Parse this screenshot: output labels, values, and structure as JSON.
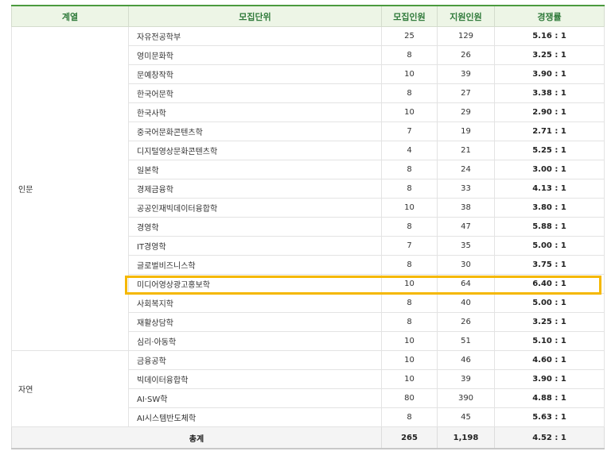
{
  "header": {
    "group": "계열",
    "unit": "모집단위",
    "quota": "모집인원",
    "applicants": "지원인원",
    "rate": "경쟁률"
  },
  "groups": [
    {
      "name": "인문",
      "rows": [
        {
          "unit": "자유전공학부",
          "quota": "25",
          "applicants": "129",
          "rate": "5.16 : 1"
        },
        {
          "unit": "영미문화학",
          "quota": "8",
          "applicants": "26",
          "rate": "3.25 : 1"
        },
        {
          "unit": "문예창작학",
          "quota": "10",
          "applicants": "39",
          "rate": "3.90 : 1"
        },
        {
          "unit": "한국어문학",
          "quota": "8",
          "applicants": "27",
          "rate": "3.38 : 1"
        },
        {
          "unit": "한국사학",
          "quota": "10",
          "applicants": "29",
          "rate": "2.90 : 1"
        },
        {
          "unit": "중국어문화콘텐츠학",
          "quota": "7",
          "applicants": "19",
          "rate": "2.71 : 1"
        },
        {
          "unit": "디지털영상문화콘텐츠학",
          "quota": "4",
          "applicants": "21",
          "rate": "5.25 : 1"
        },
        {
          "unit": "일본학",
          "quota": "8",
          "applicants": "24",
          "rate": "3.00 : 1"
        },
        {
          "unit": "경제금융학",
          "quota": "8",
          "applicants": "33",
          "rate": "4.13 : 1"
        },
        {
          "unit": "공공인재빅데이터융합학",
          "quota": "10",
          "applicants": "38",
          "rate": "3.80 : 1"
        },
        {
          "unit": "경영학",
          "quota": "8",
          "applicants": "47",
          "rate": "5.88 : 1"
        },
        {
          "unit": "IT경영학",
          "quota": "7",
          "applicants": "35",
          "rate": "5.00 : 1"
        },
        {
          "unit": "글로벌비즈니스학",
          "quota": "8",
          "applicants": "30",
          "rate": "3.75 : 1"
        },
        {
          "unit": "미디어영상광고홍보학",
          "quota": "10",
          "applicants": "64",
          "rate": "6.40 : 1"
        },
        {
          "unit": "사회복지학",
          "quota": "8",
          "applicants": "40",
          "rate": "5.00 : 1"
        },
        {
          "unit": "재활상담학",
          "quota": "8",
          "applicants": "26",
          "rate": "3.25 : 1"
        },
        {
          "unit": "심리·아동학",
          "quota": "10",
          "applicants": "51",
          "rate": "5.10 : 1"
        }
      ]
    },
    {
      "name": "자연",
      "rows": [
        {
          "unit": "금융공학",
          "quota": "10",
          "applicants": "46",
          "rate": "4.60 : 1"
        },
        {
          "unit": "빅데이터융합학",
          "quota": "10",
          "applicants": "39",
          "rate": "3.90 : 1"
        },
        {
          "unit": "AI·SW학",
          "quota": "80",
          "applicants": "390",
          "rate": "4.88 : 1"
        },
        {
          "unit": "AI시스템반도체학",
          "quota": "8",
          "applicants": "45",
          "rate": "5.63 : 1"
        }
      ]
    }
  ],
  "total": {
    "label": "총계",
    "quota": "265",
    "applicants": "1,198",
    "rate": "4.52 : 1"
  },
  "colors": {
    "header_bg": "#edf5e6",
    "header_text": "#2f7a3a",
    "highlight": "#f5b800"
  }
}
